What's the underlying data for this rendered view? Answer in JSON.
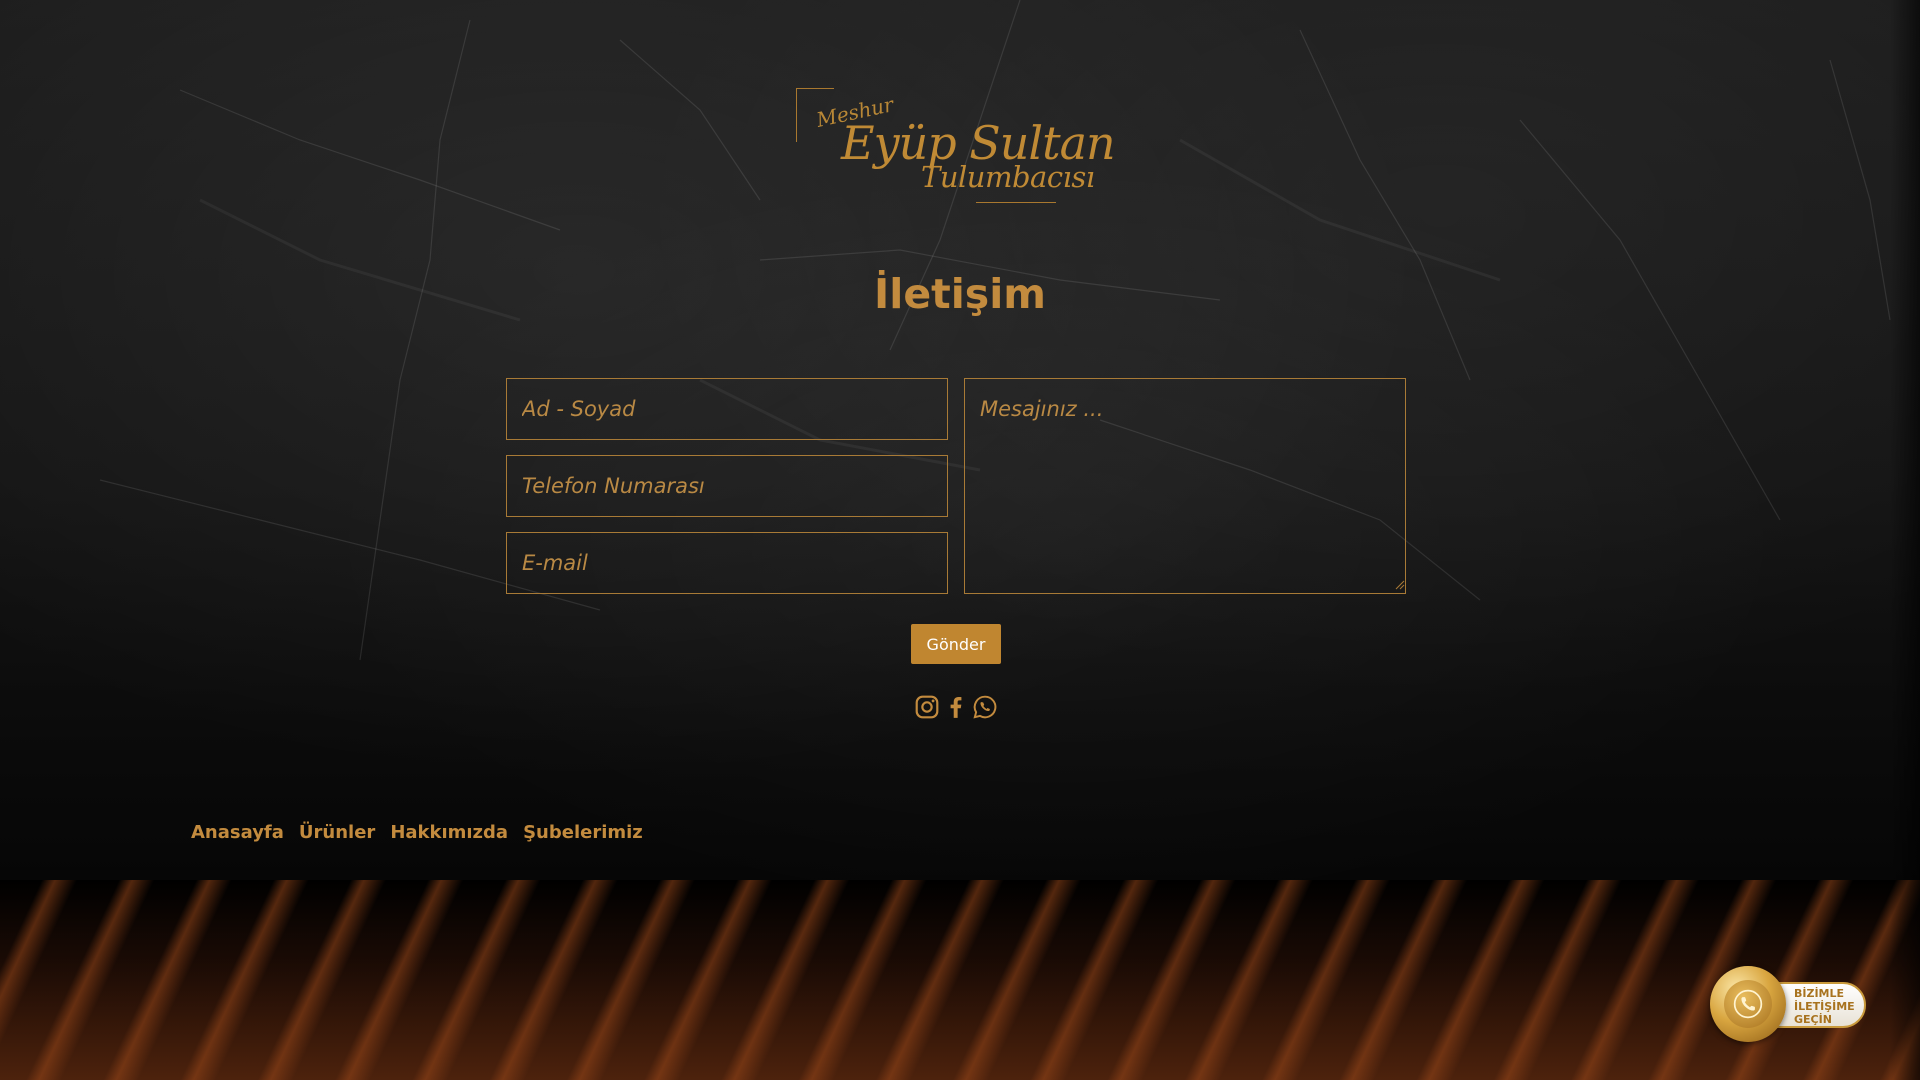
{
  "logo": {
    "top_text": "Meshur",
    "main_text": "Eyüp Sultan",
    "sub_text": "Tulumbacısı"
  },
  "page": {
    "title": "İletişim"
  },
  "form": {
    "name_placeholder": "Ad - Soyad",
    "phone_placeholder": "Telefon Numarası",
    "email_placeholder": "E-mail",
    "message_placeholder": "Mesajınız ...",
    "submit_label": "Gönder"
  },
  "social": {
    "icons": [
      "instagram-icon",
      "facebook-icon",
      "whatsapp-icon"
    ],
    "color": "#c38b3e"
  },
  "footer": {
    "nav": [
      "Anasayfa",
      "Ürünler",
      "Hakkımızda",
      "Şubelerimiz"
    ]
  },
  "contact_badge": {
    "label_line1": "BİZİMLE",
    "label_line2": "İLETİŞİME",
    "label_line3": "GEÇİN",
    "icon": "phone-icon"
  },
  "colors": {
    "accent": "#c38b3e",
    "border": "#a87a36",
    "button": "#c08630",
    "background": "#141414"
  }
}
